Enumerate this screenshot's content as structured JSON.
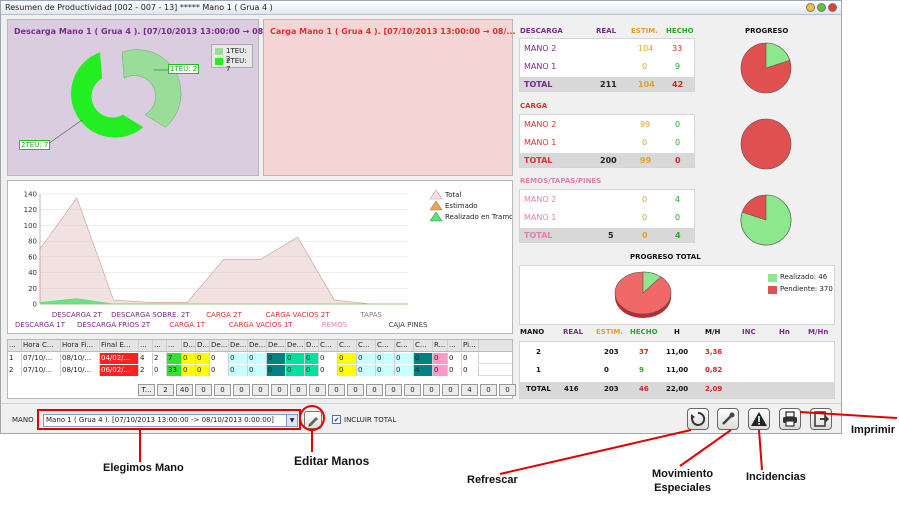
{
  "window": {
    "title": "Resumen de Productividad [002 - 007 - 13] ***** Mano 1 ( Grua 4 )"
  },
  "descarga_panel": {
    "title": "Descarga Mano 1 ( Grua 4 ). [07/10/2013 13:00:00 → 08/...",
    "legend": [
      "1TEU: 2",
      "2TEU: 7"
    ],
    "callout_1teu": "1TEU: 2",
    "callout_2teu": "2TEU: 7"
  },
  "carga_panel": {
    "title": "Carga Mano 1 ( Grua 4 ). [07/10/2013 13:00:00 → 08/..."
  },
  "chart_data": {
    "type": "area",
    "categories": [
      "DESCARGA 1T",
      "DESCARGA 2T",
      "DESCARGA FRÍOS 2T",
      "DESCARGA SOBRE. 2T",
      "CARGA 1T",
      "CARGA 2T",
      "CARGA VACÍOS 1T",
      "CARGA VACÍOS 2T",
      "REMOS",
      "TAPAS",
      "CAJA PINES"
    ],
    "series": [
      {
        "name": "Total",
        "values": [
          70,
          135,
          5,
          2,
          2,
          57,
          57,
          85,
          5,
          0,
          0
        ]
      },
      {
        "name": "Estimado",
        "values": [
          0,
          0,
          0,
          0,
          0,
          0,
          0,
          0,
          0,
          0,
          0
        ]
      },
      {
        "name": "Realizado en Tramo",
        "values": [
          2,
          7,
          0,
          0,
          0,
          0,
          0,
          0,
          0,
          0,
          0
        ]
      }
    ],
    "yticks": [
      "0",
      "20",
      "40",
      "60",
      "80",
      "100",
      "120",
      "140"
    ],
    "ylim": [
      0,
      140
    ],
    "legend_position": "top-right",
    "series_colors": [
      "#e8c8c8",
      "#e0a85a",
      "#5fe07a"
    ],
    "label_colors": [
      "#7a2a8a",
      "#7a2a8a",
      "#7a2a8a",
      "#7a2a8a",
      "#e03030",
      "#e03030",
      "#e03030",
      "#e03030",
      "#e080b0",
      "#808080",
      "#404040"
    ]
  },
  "grid": {
    "headers": [
      "...",
      "Hora C...",
      "Hora Fi...",
      "Final E...",
      "...",
      "...",
      "...",
      "D...",
      "D...",
      "De...",
      "De...",
      "De...",
      "De...",
      "De...",
      "D...",
      "C...",
      "C...",
      "C...",
      "C...",
      "C...",
      "C...",
      "R...",
      "...",
      "Pi..."
    ],
    "rows": [
      [
        "1",
        "07/10/...",
        "08/10/...",
        "04/02/...",
        "4",
        "2",
        "7",
        "0",
        "0",
        "0",
        "0",
        "0",
        "0",
        "0",
        "0",
        "0",
        "0",
        "0",
        "0",
        "0",
        "0",
        "0",
        "0",
        "0"
      ],
      [
        "2",
        "07/10/...",
        "08/10/...",
        "06/02/...",
        "2",
        "0",
        "33",
        "0",
        "0",
        "0",
        "0",
        "0",
        "0",
        "0",
        "0",
        "0",
        "0",
        "0",
        "0",
        "0",
        "4",
        "0",
        "0",
        "0"
      ]
    ],
    "totals": [
      "T...",
      "2",
      "40",
      "0",
      "0",
      "0",
      "0",
      "0",
      "0",
      "0",
      "0",
      "0",
      "0",
      "0",
      "0",
      "0",
      "0",
      "4",
      "0",
      "0"
    ],
    "cell_colors": [
      "#ffffff",
      "#ffffff",
      "#ffffff",
      "#ff2020",
      "#ffffff",
      "#ffffff",
      "#33e033",
      "#ffff00",
      "#ffff00",
      "#ffffff",
      "#c8ffff",
      "#c8ffff",
      "#008080",
      "#00e0a0",
      "#00e0a0",
      "#ffffff",
      "#ffff00",
      "#c8ffff",
      "#c8ffff",
      "#c8ffff",
      "#008080",
      "#ff99cc",
      "#ffffff",
      "#ffffff"
    ]
  },
  "summary": {
    "headers": {
      "real": "REAL",
      "estim": "ESTIM.",
      "hecho": "HECHO",
      "progreso": "PROGRESO"
    },
    "sections": [
      {
        "title": "DESCARGA",
        "rows": [
          {
            "label": "MANO 2",
            "real": "",
            "estim": "104",
            "hecho": "33"
          },
          {
            "label": "MANO 1",
            "real": "",
            "estim": "0",
            "hecho": "9"
          },
          {
            "label": "TOTAL",
            "real": "211",
            "estim": "104",
            "hecho": "42"
          }
        ],
        "progress_fraction": 0.2
      },
      {
        "title": "CARGA",
        "rows": [
          {
            "label": "MANO 2",
            "real": "",
            "estim": "99",
            "hecho": "0"
          },
          {
            "label": "MANO 1",
            "real": "",
            "estim": "0",
            "hecho": "0"
          },
          {
            "label": "TOTAL",
            "real": "200",
            "estim": "99",
            "hecho": "0"
          }
        ],
        "progress_fraction": 0.0
      },
      {
        "title": "REMOS/TAPAS/PINES",
        "rows": [
          {
            "label": "MANO 2",
            "real": "",
            "estim": "0",
            "hecho": "4"
          },
          {
            "label": "MANO 1",
            "real": "",
            "estim": "0",
            "hecho": "0"
          },
          {
            "label": "TOTAL",
            "real": "5",
            "estim": "0",
            "hecho": "4"
          }
        ],
        "progress_fraction": 0.8
      }
    ],
    "progreso_total": {
      "title": "PROGRESO TOTAL",
      "realizado": "Realizado: 46",
      "pendiente": "Pendiente: 370",
      "fraction": 0.11
    },
    "colors": {
      "descarga": "#7a2a8a",
      "carga": "#e03030",
      "remos": "#e080b0",
      "done": "#8de88d",
      "pending": "#e05050"
    }
  },
  "mano_table": {
    "headers": [
      "MANO",
      "REAL",
      "ESTIM.",
      "HECHO",
      "H",
      "M/H",
      "INC",
      "Hn",
      "M/Hn"
    ],
    "rows": [
      [
        "2",
        "",
        "203",
        "37",
        "11,00",
        "3,36",
        "",
        "",
        ""
      ],
      [
        "1",
        "",
        "0",
        "9",
        "11,00",
        "0,82",
        "",
        "",
        ""
      ],
      [
        "TOTAL",
        "416",
        "203",
        "46",
        "22,00",
        "2,09",
        "",
        "",
        ""
      ]
    ]
  },
  "bottom_bar": {
    "mano_label": "MANO",
    "mano_select": "Mano 1 ( Grua 4 ). [07/10/2013 13:00:00 -> 08/10/2013 0:00:00]",
    "incluir_total": "INCLUIR TOTAL"
  },
  "annotations": {
    "elegimos": "Elegimos Mano",
    "editar": "Editar Manos",
    "refrescar": "Refrescar",
    "movimiento": "Movimiento\nEspeciales",
    "incidencias": "Incidencias",
    "imprimir": "Imprimir"
  }
}
